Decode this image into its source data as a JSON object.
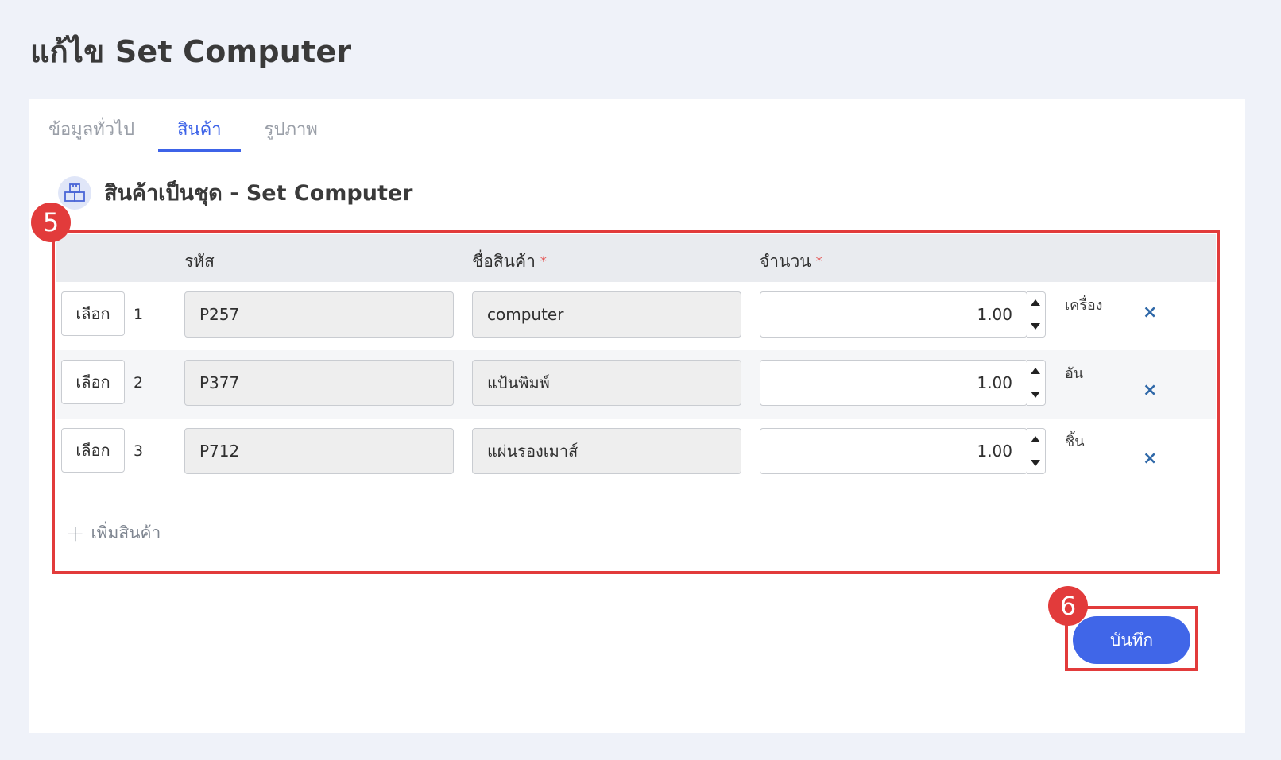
{
  "page": {
    "title": "แก้ไข Set Computer"
  },
  "tabs": [
    {
      "label": "ข้อมูลทั่วไป"
    },
    {
      "label": "สินค้า"
    },
    {
      "label": "รูปภาพ"
    }
  ],
  "section": {
    "title": "สินค้าเป็นชุด - Set Computer",
    "icon": "boxes-icon"
  },
  "table": {
    "headers": {
      "code": "รหัส",
      "name": "ชื่อสินค้า",
      "quantity": "จำนวน",
      "required_mark": "*"
    },
    "select_label": "เลือก",
    "remove_icon": "×",
    "rows": [
      {
        "num": "1",
        "code": "P257",
        "name": "computer",
        "qty": "1.00",
        "unit": "เครื่อง"
      },
      {
        "num": "2",
        "code": "P377",
        "name": "แป้นพิมพ์",
        "qty": "1.00",
        "unit": "อัน"
      },
      {
        "num": "3",
        "code": "P712",
        "name": "แผ่นรองเมาส์",
        "qty": "1.00",
        "unit": "ชิ้น"
      }
    ]
  },
  "add_product": {
    "plus": "+",
    "label": "เพิ่มสินค้า"
  },
  "save_label": "บันทึก",
  "markers": {
    "table": "5",
    "save": "6"
  },
  "colors": {
    "accent": "#4066e8",
    "marker": "#e23b3b"
  }
}
